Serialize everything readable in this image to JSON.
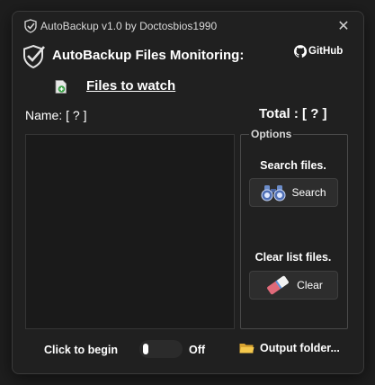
{
  "window": {
    "title": "AutoBackup v1.0 by Doctosbios1990",
    "close_glyph": "✕"
  },
  "header": {
    "title": "AutoBackup Files Monitoring:",
    "github_label": "GitHub"
  },
  "files": {
    "link_label": "Files to watch"
  },
  "summary": {
    "name_label": "Name: [ ? ]",
    "total_label": "Total : [ ? ]"
  },
  "options": {
    "legend": "Options",
    "search_heading": "Search files.",
    "search_button": "Search",
    "clear_heading": "Clear list files.",
    "clear_button": "Clear"
  },
  "footer": {
    "begin_label": "Click to begin",
    "toggle_state": "Off",
    "toggle_on": false,
    "output_button": "Output folder..."
  },
  "icons": {
    "app": "shield-check-icon",
    "header": "shield-check-icon",
    "github": "github-icon",
    "files": "file-add-icon",
    "search": "binoculars-icon",
    "clear": "eraser-icon",
    "output": "folder-icon"
  },
  "colors": {
    "background": "#202020",
    "list_background": "#1a1a1a",
    "text": "#ffffff"
  }
}
